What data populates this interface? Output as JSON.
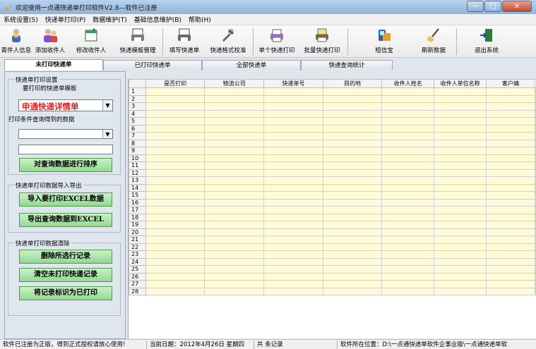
{
  "window": {
    "title": "欢迎使用一点通快递单打印软件V2.8—软件已注册",
    "min": "─",
    "max": "□",
    "close": "✕"
  },
  "menu": [
    "系统设置(S)",
    "快递单打印(P)",
    "数据维护(T)",
    "基础信息维护(B)",
    "帮助(H)"
  ],
  "toolbar": [
    {
      "label": "寄件人信息",
      "icon": "sender-person-icon"
    },
    {
      "label": "添加收件人",
      "icon": "add-recipient-icon"
    },
    {
      "label": "修改收件人",
      "icon": "edit-recipient-icon"
    },
    {
      "label": "快递模板管理",
      "icon": "template-manage-icon"
    },
    {
      "label": "填写快递单",
      "icon": "fill-waybill-icon"
    },
    {
      "label": "快递格式校准",
      "icon": "format-calibrate-icon"
    },
    {
      "label": "单个快递打印",
      "icon": "single-print-icon"
    },
    {
      "label": "批量快递打印",
      "icon": "batch-print-icon"
    },
    {
      "label": "短信宝",
      "icon": "sms-icon"
    },
    {
      "label": "刷新数据",
      "icon": "refresh-broom-icon"
    },
    {
      "label": "退出系统",
      "icon": "exit-door-icon"
    }
  ],
  "tabs": [
    "未打印快递单",
    "已打印快递单",
    "全部快递单",
    "快递查询统计"
  ],
  "panel": {
    "group1": {
      "title": "快递单打印设置",
      "template_label": "要打印的快递单模板",
      "template_value": "申通快递详情单",
      "filter_label": "打印条件查询得到的数据",
      "filter_value": "",
      "search_value": "",
      "sort_button": "对查询数据进行排序"
    },
    "group2": {
      "title": "快递单打印数据导入导出",
      "import_button": "导入要打印EXCEL数据",
      "export_button": "导出查询数据到EXCEL"
    },
    "group3": {
      "title": "快递单打印数据清除",
      "delete_button": "删除所选行记录",
      "clear_button": "清空未打印快递记录",
      "mark_button": "将记录标识为已打印"
    }
  },
  "grid": {
    "columns": [
      "是否打印",
      "物流公司",
      "快递单号",
      "目的地",
      "收件人姓名",
      "收件人单位名称",
      "客户编"
    ],
    "row_count": 28
  },
  "status": {
    "license": "软件已注册为正版，得到正式授权请放心使用!",
    "date": "当前日期：2012年4月26日 星期四",
    "records": "共   条记录",
    "path": "软件所在位置：D:\\一点通快递单软件企事业版\\一点通快递单软"
  },
  "colors": {
    "accent_green": "#92d892",
    "template_red": "#e2211c",
    "grid_cell": "#fffbd6"
  }
}
